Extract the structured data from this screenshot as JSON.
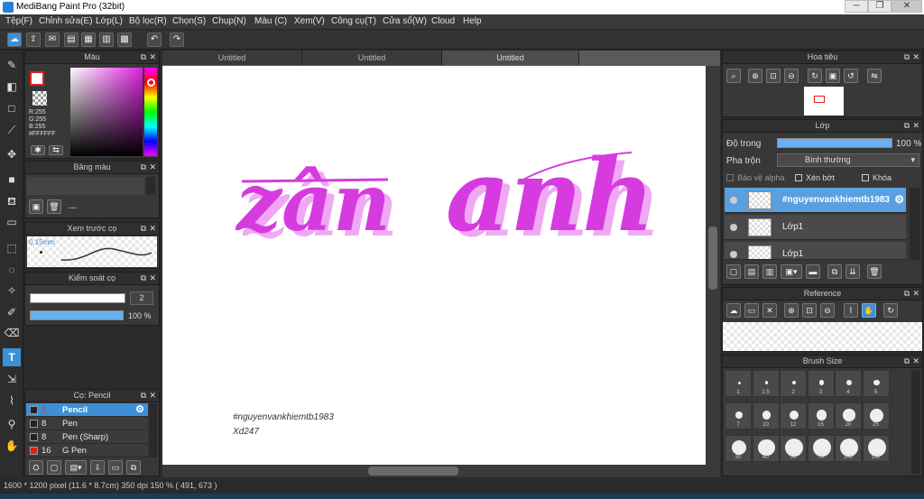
{
  "app": {
    "title": "MediBang Paint Pro (32bit)"
  },
  "window": {
    "min": "─",
    "max": "❐",
    "close": "✕"
  },
  "menu": [
    "Tệp(F)",
    "Chỉnh sửa(E)",
    "Lớp(L)",
    "Bộ lọc(R)",
    "Chọn(S)",
    "Chụp(N)",
    "Màu (C)",
    "Xem(V)",
    "Công cụ(T)",
    "Cửa sổ(W)",
    "Cloud",
    "Help"
  ],
  "tabs": [
    "Untitled",
    "Untitled",
    "Untitled"
  ],
  "color_panel": {
    "title": "Màu",
    "r": "R:255",
    "g": "G:255",
    "b": "B:255",
    "hex": "#FFFFFF"
  },
  "palette_panel": {
    "title": "Bảng màu",
    "dash": "---"
  },
  "brush_preview": {
    "title": "Xem trước cọ",
    "size": "0.15mm"
  },
  "brush_control": {
    "title": "Kiểm soát cọ",
    "size_value": "2",
    "opacity_value": "100 %",
    "opacity": 1.0
  },
  "brush_list": {
    "title": "Cọ: Pencil",
    "items": [
      {
        "size": "2",
        "name": "Pencil",
        "color": "#222222",
        "selected": true
      },
      {
        "size": "8",
        "name": "Pen",
        "color": "#222222",
        "selected": false
      },
      {
        "size": "8",
        "name": "Pen (Sharp)",
        "color": "#222222",
        "selected": false
      },
      {
        "size": "16",
        "name": "G Pen",
        "color": "#e02020",
        "selected": false
      }
    ]
  },
  "navigator": {
    "title": "Hoa tiêu"
  },
  "layers": {
    "title": "Lớp",
    "opacity_label": "Độ trong",
    "opacity_value": "100 %",
    "opacity": 1.0,
    "blend_label": "Pha trộn",
    "blend_value": "Bình thường",
    "protect_alpha": "Bảo vệ alpha",
    "clipping": "Xén bớt",
    "lock": "Khóa",
    "items": [
      {
        "name": "#nguyenvankhiemtb1983",
        "selected": true
      },
      {
        "name": "Lớp1",
        "selected": false
      },
      {
        "name": "Lớp1",
        "selected": false
      }
    ]
  },
  "reference": {
    "title": "Reference"
  },
  "brush_size": {
    "title": "Brush Size",
    "sizes": [
      "1",
      "1.5",
      "2",
      "3",
      "4",
      "5",
      "7",
      "10",
      "12",
      "15",
      "20",
      "25",
      "30",
      "40",
      "50",
      "70",
      "100",
      "150"
    ]
  },
  "canvas": {
    "word1": "zân",
    "word2": "anh",
    "watermark1": "#nguyenvankhiemtb1983",
    "watermark2": "Xd247",
    "text_color": "#d63be0",
    "shadow_color": "#f0a8f5"
  },
  "status": {
    "text": "1600 * 1200 pixel  (11.6 * 8.7cm)  350 dpi  150 %  ( 491, 673 )"
  }
}
